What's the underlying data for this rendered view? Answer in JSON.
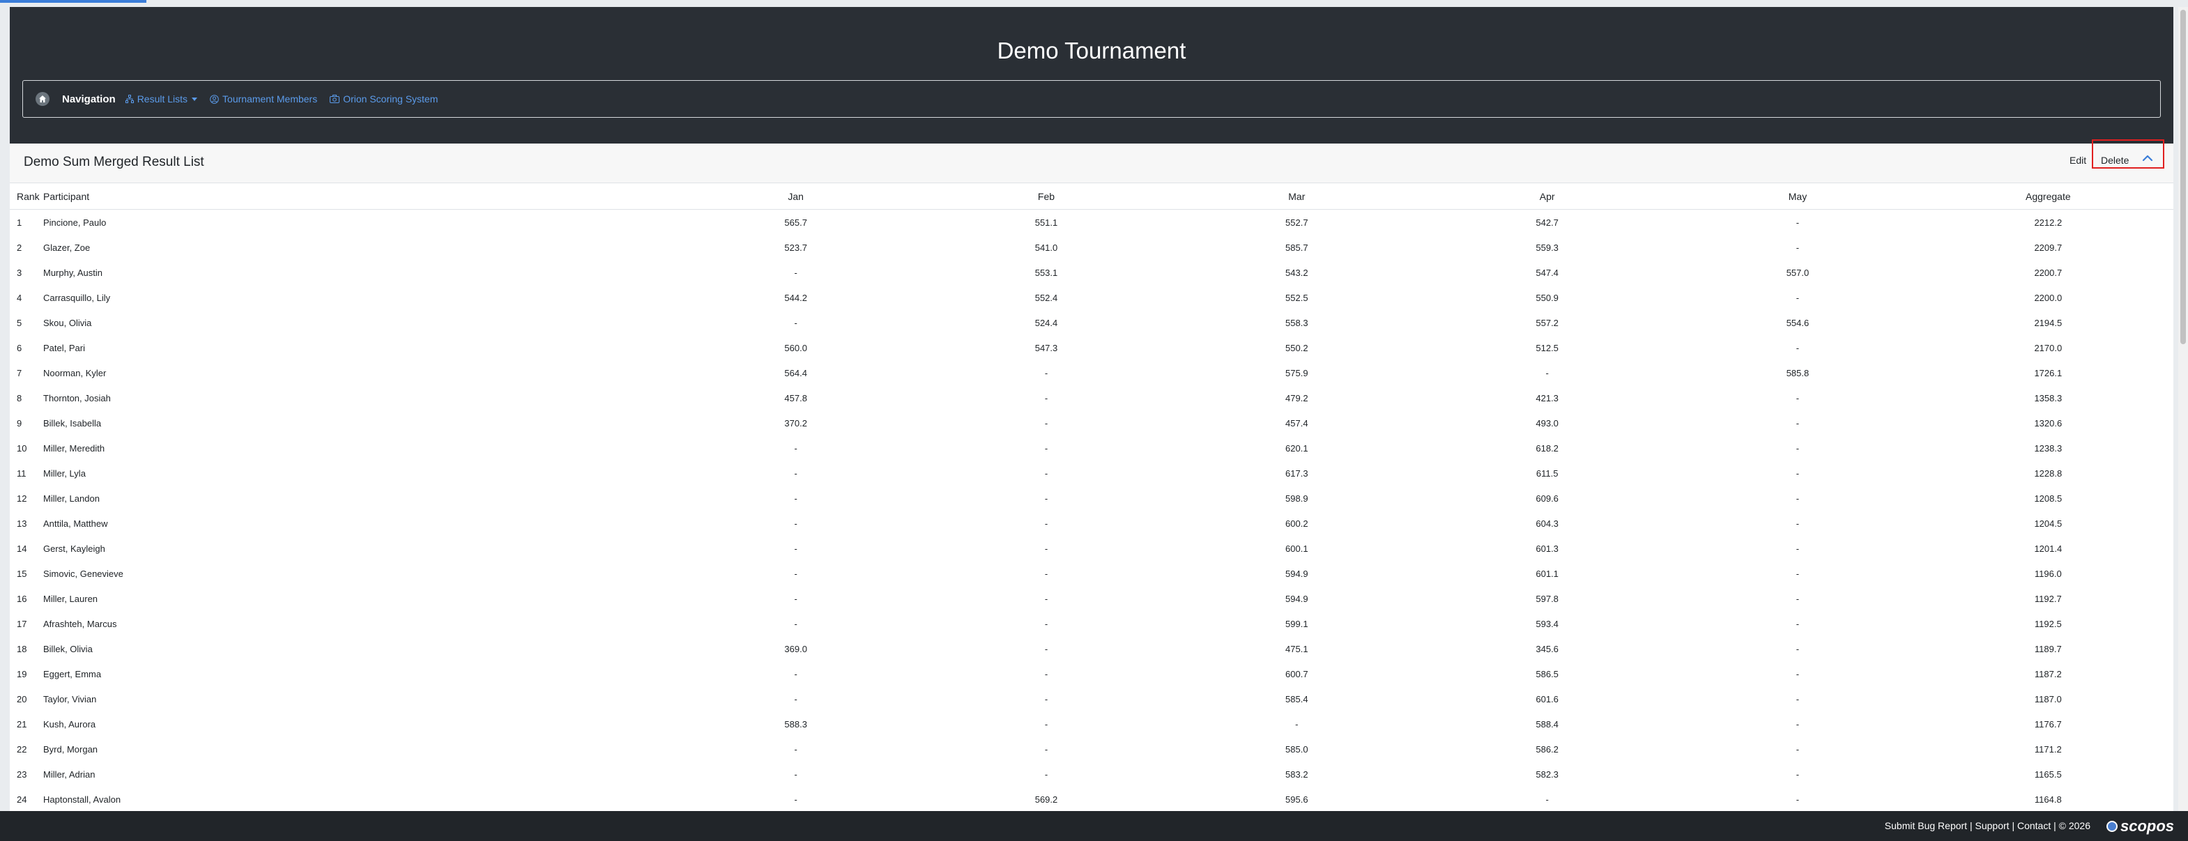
{
  "header": {
    "title": "Demo Tournament"
  },
  "nav": {
    "home_icon": "home-icon",
    "label": "Navigation",
    "links": [
      {
        "label": "Result Lists",
        "icon": "sitemap-icon"
      },
      {
        "label": "Tournament Members",
        "icon": "user-circle-icon"
      },
      {
        "label": "Orion Scoring System",
        "icon": "camera-icon"
      }
    ]
  },
  "card": {
    "title": "Demo Sum Merged Result List",
    "edit_label": "Edit",
    "delete_label": "Delete"
  },
  "table": {
    "columns": [
      "Rank",
      "Participant",
      "Jan",
      "Feb",
      "Mar",
      "Apr",
      "May",
      "Aggregate"
    ],
    "rows": [
      [
        "1",
        "Pincione, Paulo",
        "565.7",
        "551.1",
        "552.7",
        "542.7",
        "-",
        "2212.2"
      ],
      [
        "2",
        "Glazer, Zoe",
        "523.7",
        "541.0",
        "585.7",
        "559.3",
        "-",
        "2209.7"
      ],
      [
        "3",
        "Murphy, Austin",
        "-",
        "553.1",
        "543.2",
        "547.4",
        "557.0",
        "2200.7"
      ],
      [
        "4",
        "Carrasquillo, Lily",
        "544.2",
        "552.4",
        "552.5",
        "550.9",
        "-",
        "2200.0"
      ],
      [
        "5",
        "Skou, Olivia",
        "-",
        "524.4",
        "558.3",
        "557.2",
        "554.6",
        "2194.5"
      ],
      [
        "6",
        "Patel, Pari",
        "560.0",
        "547.3",
        "550.2",
        "512.5",
        "-",
        "2170.0"
      ],
      [
        "7",
        "Noorman, Kyler",
        "564.4",
        "-",
        "575.9",
        "-",
        "585.8",
        "1726.1"
      ],
      [
        "8",
        "Thornton, Josiah",
        "457.8",
        "-",
        "479.2",
        "421.3",
        "-",
        "1358.3"
      ],
      [
        "9",
        "Billek, Isabella",
        "370.2",
        "-",
        "457.4",
        "493.0",
        "-",
        "1320.6"
      ],
      [
        "10",
        "Miller, Meredith",
        "-",
        "-",
        "620.1",
        "618.2",
        "-",
        "1238.3"
      ],
      [
        "11",
        "Miller, Lyla",
        "-",
        "-",
        "617.3",
        "611.5",
        "-",
        "1228.8"
      ],
      [
        "12",
        "Miller, Landon",
        "-",
        "-",
        "598.9",
        "609.6",
        "-",
        "1208.5"
      ],
      [
        "13",
        "Anttila, Matthew",
        "-",
        "-",
        "600.2",
        "604.3",
        "-",
        "1204.5"
      ],
      [
        "14",
        "Gerst, Kayleigh",
        "-",
        "-",
        "600.1",
        "601.3",
        "-",
        "1201.4"
      ],
      [
        "15",
        "Simovic, Genevieve",
        "-",
        "-",
        "594.9",
        "601.1",
        "-",
        "1196.0"
      ],
      [
        "16",
        "Miller, Lauren",
        "-",
        "-",
        "594.9",
        "597.8",
        "-",
        "1192.7"
      ],
      [
        "17",
        "Afrashteh, Marcus",
        "-",
        "-",
        "599.1",
        "593.4",
        "-",
        "1192.5"
      ],
      [
        "18",
        "Billek, Olivia",
        "369.0",
        "-",
        "475.1",
        "345.6",
        "-",
        "1189.7"
      ],
      [
        "19",
        "Eggert, Emma",
        "-",
        "-",
        "600.7",
        "586.5",
        "-",
        "1187.2"
      ],
      [
        "20",
        "Taylor, Vivian",
        "-",
        "-",
        "585.4",
        "601.6",
        "-",
        "1187.0"
      ],
      [
        "21",
        "Kush, Aurora",
        "588.3",
        "-",
        "-",
        "588.4",
        "-",
        "1176.7"
      ],
      [
        "22",
        "Byrd, Morgan",
        "-",
        "-",
        "585.0",
        "586.2",
        "-",
        "1171.2"
      ],
      [
        "23",
        "Miller, Adrian",
        "-",
        "-",
        "583.2",
        "582.3",
        "-",
        "1165.5"
      ],
      [
        "24",
        "Haptonstall, Avalon",
        "-",
        "569.2",
        "595.6",
        "-",
        "-",
        "1164.8"
      ]
    ]
  },
  "footer": {
    "links": [
      "Submit Bug Report",
      "Support",
      "Contact"
    ],
    "copyright": "© 2026",
    "logo_text": "scopos"
  },
  "colors": {
    "hero_bg": "#2a2f35",
    "link": "#5b9bea",
    "highlight_box": "#e02020",
    "footer_bg": "#212529"
  }
}
